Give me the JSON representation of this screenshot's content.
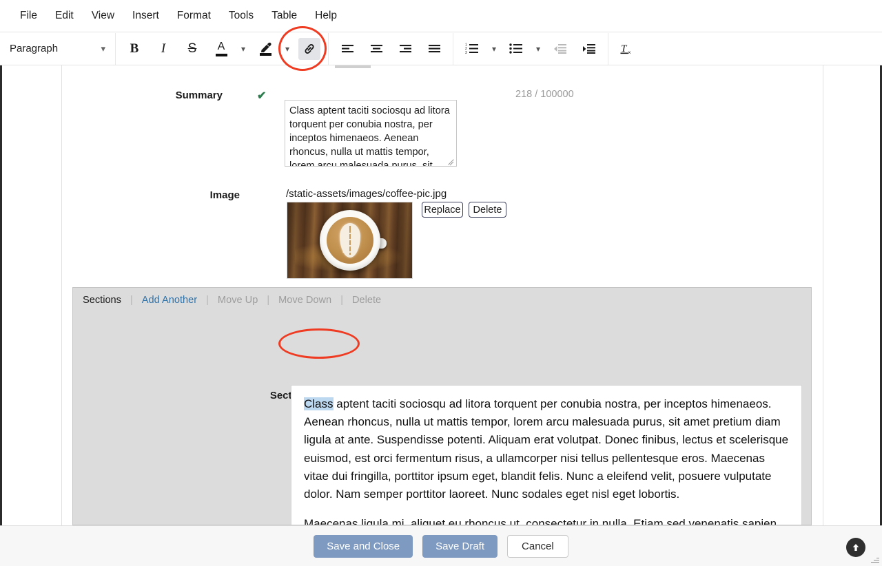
{
  "menubar": {
    "items": [
      {
        "label": "File"
      },
      {
        "label": "Edit"
      },
      {
        "label": "View"
      },
      {
        "label": "Insert"
      },
      {
        "label": "Format"
      },
      {
        "label": "Tools"
      },
      {
        "label": "Table"
      },
      {
        "label": "Help"
      }
    ]
  },
  "toolbar": {
    "format_select": {
      "value": "Paragraph",
      "chevron": "⌄"
    },
    "bold": {
      "glyph": "B",
      "name": "bold"
    },
    "italic": {
      "glyph": "I",
      "name": "italic"
    },
    "strikethrough": {
      "glyph": "S",
      "name": "strikethrough"
    },
    "text_color": {
      "glyph": "A",
      "name": "text-color"
    },
    "highlight": {
      "name": "highlight-color"
    },
    "link": {
      "name": "insert-link",
      "state": "active"
    },
    "align_left": {
      "name": "align-left"
    },
    "align_center": {
      "name": "align-center"
    },
    "align_right": {
      "name": "align-right"
    },
    "align_justify": {
      "name": "align-justify"
    },
    "numbered_list": {
      "name": "numbered-list"
    },
    "bullet_list": {
      "name": "bullet-list"
    },
    "outdent": {
      "name": "outdent",
      "state": "disabled"
    },
    "indent": {
      "name": "indent"
    },
    "clear_formatting": {
      "name": "clear-formatting",
      "glyph": "I"
    },
    "chevron": "⌄"
  },
  "annotations": {
    "link_button_ring_color": "#ee3b21",
    "selection_ring_color": "#ee3b21"
  },
  "form": {
    "summary": {
      "label": "Summary",
      "valid_check": "✔",
      "counter": "218 / 100000",
      "value": "Class aptent taciti sociosqu ad litora torquent per conubia nostra, per inceptos himenaeos. Aenean rhoncus, nulla ut mattis tempor, lorem arcu malesuada purus, sit"
    },
    "image": {
      "label": "Image",
      "path": "/static-assets/images/coffee-pic.jpg",
      "replace_label": "Replace",
      "delete_label": "Delete",
      "alt": "coffee cup with latte art leaf on wooden table"
    }
  },
  "sections": {
    "title": "Sections",
    "actions": [
      {
        "label": "Add Another",
        "state": "link"
      },
      {
        "label": "Move Up",
        "state": "disabled"
      },
      {
        "label": "Move Down",
        "state": "disabled"
      },
      {
        "label": "Delete",
        "state": "disabled"
      }
    ],
    "section": {
      "label": "Section",
      "valid_check": "✔",
      "selected_text": "Class",
      "paragraph_1_rest": " aptent taciti sociosqu ad litora torquent per conubia nostra, per inceptos himenaeos. Aenean rhoncus, nulla ut mattis tempor, lorem arcu malesuada purus, sit amet pretium diam ligula at ante. Suspendisse potenti. Aliquam erat volutpat. Donec finibus, lectus et scelerisque euismod, est orci fermentum risus, a ullamcorper nisi tellus pellentesque eros. Maecenas vitae dui fringilla, porttitor ipsum eget, blandit felis. Nunc a eleifend velit, posuere vulputate dolor. Nam semper porttitor laoreet. Nunc sodales eget nisl eget lobortis.",
      "paragraph_2": "Maecenas ligula mi, aliquet eu rhoncus ut, consectetur in nulla. Etiam sed venenatis sapien. Aenean ullamcorper, turpis vitae interdum malesuada, turpis leo interdum nisi, a placerat sem dui at justo. Aliquam a lobortis orci. Etiam"
    }
  },
  "footer": {
    "save_and_close": "Save and Close",
    "save_draft": "Save Draft",
    "cancel": "Cancel",
    "primary_color": "#7f9ac0",
    "scroll_to_top": "↑"
  }
}
